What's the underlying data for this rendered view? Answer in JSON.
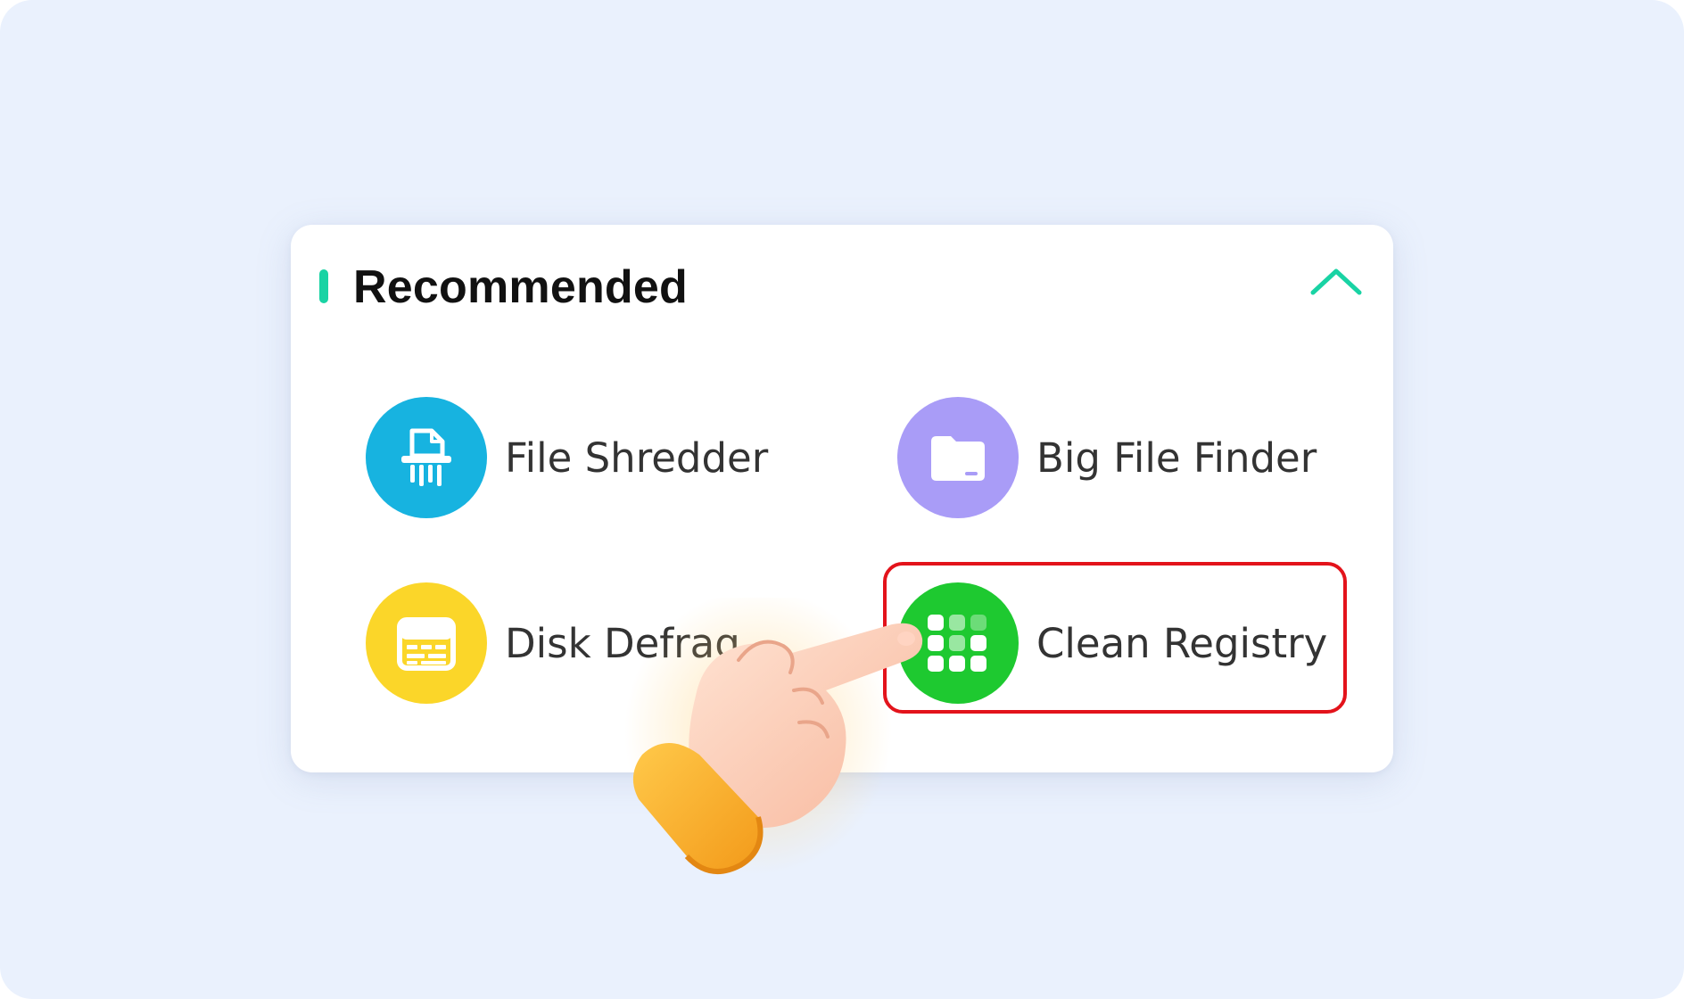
{
  "panel": {
    "title": "Recommended",
    "accent_color": "#19d3a4",
    "collapse_icon": "chevron-up-icon"
  },
  "tools": [
    {
      "label": "File Shredder",
      "icon": "shredder-icon",
      "color": "#17b3e0"
    },
    {
      "label": "Big File Finder",
      "icon": "folder-icon",
      "color": "#a99cf7"
    },
    {
      "label": "Disk Defrag",
      "icon": "defrag-icon",
      "color": "#fbd629"
    },
    {
      "label": "Clean Registry",
      "icon": "registry-grid-icon",
      "color": "#1ec930"
    }
  ],
  "highlight": {
    "target": "Clean Registry",
    "color": "#e3131b"
  },
  "pointer": {
    "icon": "pointing-hand-icon"
  }
}
